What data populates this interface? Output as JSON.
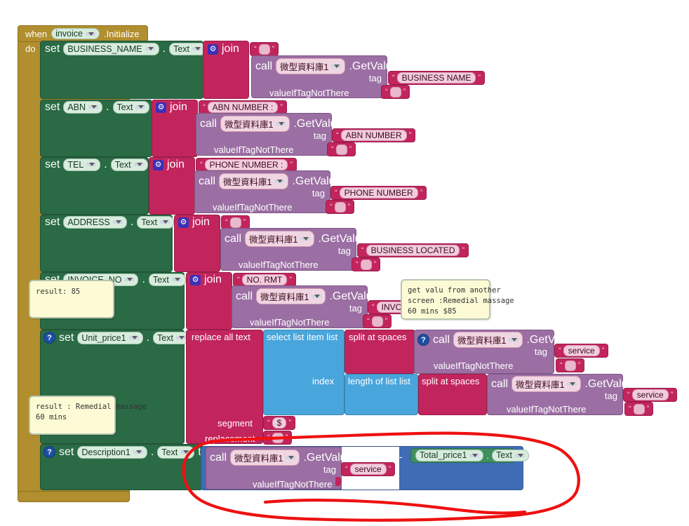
{
  "app": {
    "editor": "MIT App Inventor Blocks Editor",
    "canvas_background": "#ffffff"
  },
  "colors": {
    "event_block": "#b18e2e",
    "setter_block": "#2a6a45",
    "text_block": "#c2255c",
    "tinydb_block": "#9b6fa3",
    "list_block": "#49a6dc",
    "math_block": "#3f6cb5",
    "getter_block": "#3f8f5f",
    "annotation": "#ee1111",
    "comment_bubble": "#fdfbd5"
  },
  "event": {
    "when_label": "when",
    "component": "invoice",
    "event_name": ".Initialize",
    "do_label": "do"
  },
  "labels": {
    "set": "set",
    "to": "to",
    "dot": ".",
    "text_prop": "Text",
    "call": "call",
    "get_value": ".GetValue",
    "tag": "tag",
    "value_if_tag_not_there": "valueIfTagNotThere",
    "join": "join",
    "replace_all_text": "replace all text",
    "select_list_item": "select list item",
    "list": "list",
    "index": "index",
    "split_at_spaces": "split at spaces",
    "length_of_list": "length of list",
    "segment": "segment",
    "replacement": "replacement",
    "minus": "-",
    "tinydb": "微型資料庫1"
  },
  "rows": [
    {
      "id": "business-name",
      "setter": "BUSINESS_NAME",
      "property": "Text",
      "operation": "join",
      "first_text": "",
      "tag": "BUSINESS NAME",
      "value_if_not_there": ""
    },
    {
      "id": "abn",
      "setter": "ABN",
      "property": "Text",
      "operation": "join",
      "first_text": "ABN NUMBER :",
      "tag": "ABN NUMBER",
      "value_if_not_there": ""
    },
    {
      "id": "tel",
      "setter": "TEL",
      "property": "Text",
      "operation": "join",
      "first_text": "PHONE NUMBER :",
      "tag": "PHONE NUMBER",
      "value_if_not_there": ""
    },
    {
      "id": "address",
      "setter": "ADDRESS",
      "property": "Text",
      "operation": "join",
      "first_text": "",
      "tag": "BUSINESS LOCATED",
      "value_if_not_there": ""
    },
    {
      "id": "invoice-no",
      "setter": "INVOICE_NO",
      "property": "Text",
      "operation": "join",
      "first_text": "NO. RMT",
      "tag": "INVOIC",
      "value_if_not_there": ""
    }
  ],
  "unit_price_row": {
    "setter": "Unit_price1",
    "property": "Text",
    "operation": "replace all text",
    "select_list_item_label": "select list item",
    "list_label": "list",
    "split_label": "split at spaces",
    "tag_1": "service",
    "value_if_not_there_1": "",
    "index_label": "index",
    "length_of_list_label": "length of list",
    "tag_2": "service",
    "value_if_not_there_2": "",
    "segment": "$",
    "replacement": ""
  },
  "description_row": {
    "setter": "Description1",
    "property": "Text",
    "tag": "service",
    "value_if_not_there": "",
    "operator": "-",
    "right_component": "Total_price1",
    "right_property": "Text"
  },
  "comments": [
    {
      "id": "invoice-result-comment",
      "lines": [
        "result: 85"
      ]
    },
    {
      "id": "unit-price-comment",
      "lines": [
        "get valu from another",
        "screen :Remedial massage",
        "60 mins $85"
      ]
    },
    {
      "id": "description-result-comment",
      "lines": [
        "result : Remedial massage",
        "60 mins"
      ]
    }
  ],
  "annotation": {
    "shape": "hand-drawn-red-ellipse",
    "target": "description-row-value-expression"
  }
}
